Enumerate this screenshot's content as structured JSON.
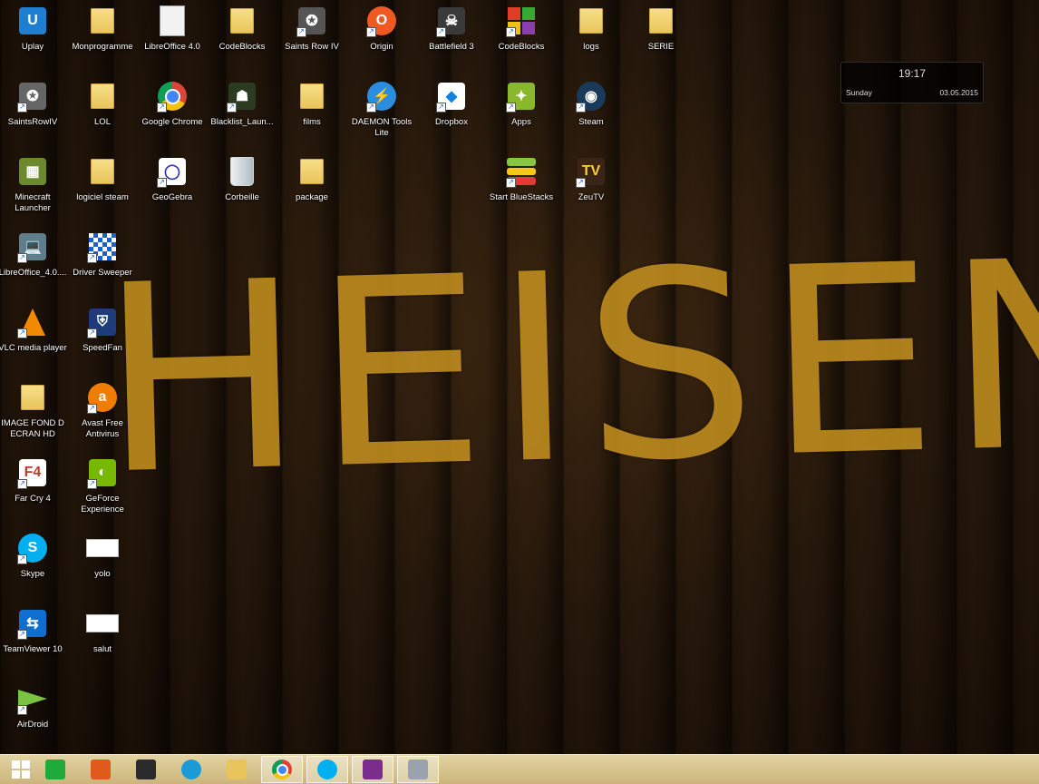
{
  "wallpaper": {
    "text": "HEISENBE"
  },
  "icons": [
    {
      "label": "Uplay",
      "col": 0,
      "row": 0,
      "kind": "tile",
      "color": "#1d7fd1",
      "glyph": "U",
      "shortcut": false
    },
    {
      "label": "Monprogramme",
      "col": 1,
      "row": 0,
      "kind": "folder",
      "shortcut": false
    },
    {
      "label": "LibreOffice 4.0",
      "col": 2,
      "row": 0,
      "kind": "doc-file",
      "shortcut": false
    },
    {
      "label": "CodeBlocks",
      "col": 3,
      "row": 0,
      "kind": "folder",
      "shortcut": false
    },
    {
      "label": "Saints Row IV",
      "col": 4,
      "row": 0,
      "kind": "tile",
      "color": "#555555",
      "glyph": "✪",
      "shortcut": true
    },
    {
      "label": "Origin",
      "col": 5,
      "row": 0,
      "kind": "round",
      "color": "#f05a22",
      "glyph": "O",
      "shortcut": true
    },
    {
      "label": "Battlefield 3",
      "col": 6,
      "row": 0,
      "kind": "tile",
      "color": "#3a3a3a",
      "glyph": "☠",
      "shortcut": true
    },
    {
      "label": "CodeBlocks",
      "col": 7,
      "row": 0,
      "kind": "grid4",
      "shortcut": true
    },
    {
      "label": "logs",
      "col": 8,
      "row": 0,
      "kind": "folder",
      "shortcut": false
    },
    {
      "label": "SERIE",
      "col": 9,
      "row": 0,
      "kind": "folder",
      "shortcut": false
    },
    {
      "label": "SaintsRowIV",
      "col": 0,
      "row": 1,
      "kind": "tile",
      "color": "#666666",
      "glyph": "✪",
      "shortcut": true
    },
    {
      "label": "LOL",
      "col": 1,
      "row": 1,
      "kind": "folder",
      "shortcut": false
    },
    {
      "label": "Google Chrome",
      "col": 2,
      "row": 1,
      "kind": "chrome",
      "shortcut": true
    },
    {
      "label": "Blacklist_Laun...",
      "col": 3,
      "row": 1,
      "kind": "tile",
      "color": "#2d3a22",
      "glyph": "☗",
      "shortcut": true
    },
    {
      "label": "films",
      "col": 4,
      "row": 1,
      "kind": "folder",
      "shortcut": false
    },
    {
      "label": "DAEMON Tools Lite",
      "col": 5,
      "row": 1,
      "kind": "round",
      "color": "#2a8de0",
      "glyph": "⚡",
      "shortcut": true
    },
    {
      "label": "Dropbox",
      "col": 6,
      "row": 1,
      "kind": "tile",
      "color": "#ffffff",
      "glyph": "◆",
      "fg": "#1081de",
      "shortcut": true
    },
    {
      "label": "Apps",
      "col": 7,
      "row": 1,
      "kind": "tile",
      "color": "#8ab82d",
      "glyph": "✦",
      "shortcut": true
    },
    {
      "label": "Steam",
      "col": 8,
      "row": 1,
      "kind": "round",
      "color": "#1a3a5c",
      "glyph": "◉",
      "shortcut": true
    },
    {
      "label": "Minecraft Launcher",
      "col": 0,
      "row": 2,
      "kind": "tile",
      "color": "#6b8a2e",
      "glyph": "▦",
      "shortcut": false
    },
    {
      "label": "logiciel steam",
      "col": 1,
      "row": 2,
      "kind": "folder",
      "shortcut": false
    },
    {
      "label": "GeoGebra",
      "col": 2,
      "row": 2,
      "kind": "tile",
      "color": "#ffffff",
      "glyph": "◯",
      "fg": "#3333aa",
      "shortcut": true
    },
    {
      "label": "Corbeille",
      "col": 3,
      "row": 2,
      "kind": "bin",
      "shortcut": false
    },
    {
      "label": "package",
      "col": 4,
      "row": 2,
      "kind": "folder",
      "shortcut": false
    },
    {
      "label": "Start BlueStacks",
      "col": 7,
      "row": 2,
      "kind": "stack",
      "shortcut": true
    },
    {
      "label": "ZeuTV",
      "col": 8,
      "row": 2,
      "kind": "tile",
      "color": "#3a2416",
      "glyph": "TV",
      "fg": "#ffcc33",
      "shortcut": true
    },
    {
      "label": "LibreOffice_4.0....",
      "col": 0,
      "row": 3,
      "kind": "tile",
      "color": "#607d8b",
      "glyph": "💻",
      "shortcut": true
    },
    {
      "label": "Driver Sweeper",
      "col": 1,
      "row": 3,
      "kind": "grid-blue",
      "shortcut": true
    },
    {
      "label": "VLC media player",
      "col": 0,
      "row": 4,
      "kind": "cone",
      "shortcut": true
    },
    {
      "label": "SpeedFan",
      "col": 1,
      "row": 4,
      "kind": "tile",
      "color": "#1f3c7a",
      "glyph": "⛨",
      "shortcut": true
    },
    {
      "label": "IMAGE FOND D ECRAN HD",
      "col": 0,
      "row": 5,
      "kind": "folder",
      "shortcut": false
    },
    {
      "label": "Avast Free Antivirus",
      "col": 1,
      "row": 5,
      "kind": "round",
      "color": "#f07d00",
      "glyph": "a",
      "shortcut": true
    },
    {
      "label": "Far Cry 4",
      "col": 0,
      "row": 6,
      "kind": "tile",
      "color": "#ffffff",
      "glyph": "F4",
      "fg": "#c0392b",
      "shortcut": true
    },
    {
      "label": "GeForce Experience",
      "col": 1,
      "row": 6,
      "kind": "tile",
      "color": "#76b900",
      "glyph": "◐",
      "shortcut": true
    },
    {
      "label": "Skype",
      "col": 0,
      "row": 7,
      "kind": "round",
      "color": "#00aff0",
      "glyph": "S",
      "shortcut": true
    },
    {
      "label": "yolo",
      "col": 1,
      "row": 7,
      "kind": "doc",
      "shortcut": false
    },
    {
      "label": "TeamViewer 10",
      "col": 0,
      "row": 8,
      "kind": "tile",
      "color": "#0e6fd0",
      "glyph": "⇆",
      "shortcut": true
    },
    {
      "label": "salut",
      "col": 1,
      "row": 8,
      "kind": "doc",
      "shortcut": false
    },
    {
      "label": "AirDroid",
      "col": 0,
      "row": 9,
      "kind": "plane",
      "shortcut": true
    }
  ],
  "gadget": {
    "time": "19:17",
    "day": "Sunday",
    "date": "03.05.2015"
  },
  "taskbar": [
    {
      "name": "start-button",
      "icon": "windows-logo-icon"
    },
    {
      "name": "taskbar-store",
      "icon": "store-icon",
      "color": "#1faa3a"
    },
    {
      "name": "taskbar-app-2",
      "icon": "app-icon",
      "color": "#e05a1c"
    },
    {
      "name": "taskbar-app-3",
      "icon": "chart-app-icon",
      "color": "#2b2b2b"
    },
    {
      "name": "taskbar-app-4",
      "icon": "globe-icon",
      "color": "#1a9bd7"
    },
    {
      "name": "taskbar-explorer",
      "icon": "folder-icon",
      "color": "#e8c45a"
    },
    {
      "name": "taskbar-chrome",
      "icon": "chrome-icon",
      "active": true
    },
    {
      "name": "taskbar-skype",
      "icon": "skype-icon",
      "color": "#00aff0",
      "active": true
    },
    {
      "name": "taskbar-winrar",
      "icon": "archive-icon",
      "color": "#7b2d8e",
      "active": true
    },
    {
      "name": "taskbar-app-9",
      "icon": "tool-icon",
      "color": "#9aa3ad",
      "active": true
    }
  ]
}
